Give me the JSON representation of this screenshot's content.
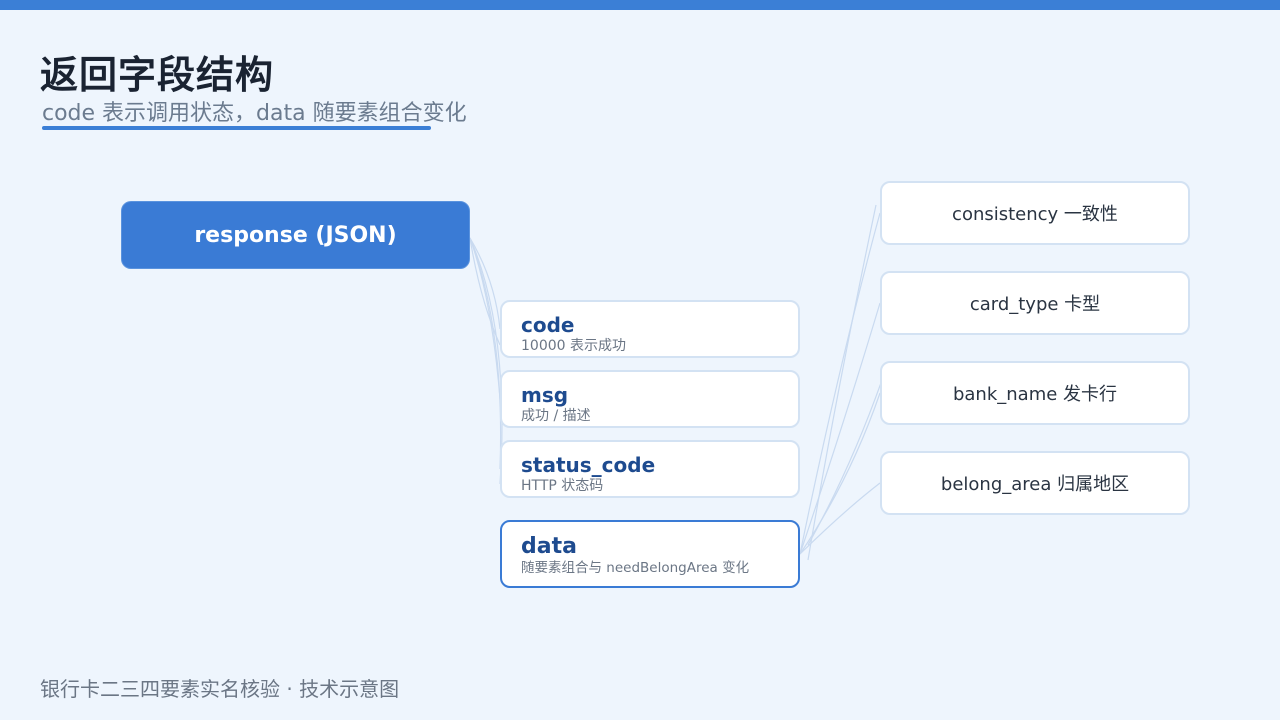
{
  "header": {
    "title": "返回字段结构",
    "subtitle": "code 表示调用状态，data 随要素组合变化"
  },
  "diagram": {
    "root": {
      "label": "response (JSON)"
    },
    "fields": [
      {
        "name": "code",
        "desc": "10000 表示成功"
      },
      {
        "name": "msg",
        "desc": "成功 / 描述"
      },
      {
        "name": "status_code",
        "desc": "HTTP 状态码"
      },
      {
        "name": "data",
        "desc": "随要素组合与 needBelongArea 变化"
      }
    ],
    "data_children": [
      {
        "label": "consistency 一致性"
      },
      {
        "label": "card_type 卡型"
      },
      {
        "label": "bank_name 发卡行"
      },
      {
        "label": "belong_area 归属地区"
      }
    ]
  },
  "footer": {
    "text": "银行卡二三四要素实名核验 · 技术示意图"
  },
  "colors": {
    "accent": "#3b7fd6",
    "root_fill": "#3a7bd5",
    "field_name": "#1e4b8f",
    "connector": "#c9daf0",
    "background": "#eef5fd"
  }
}
